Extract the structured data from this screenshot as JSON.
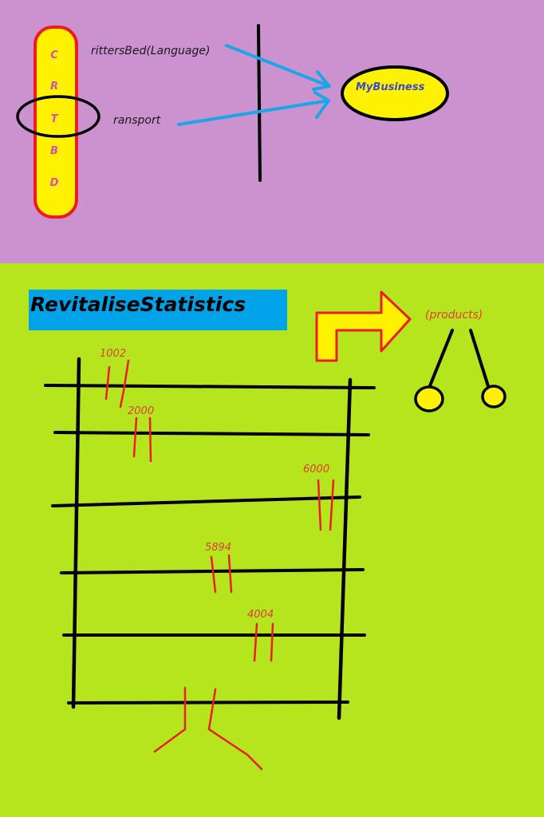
{
  "top_panel": {
    "letters": [
      "C",
      "R",
      "T",
      "B",
      "D"
    ],
    "label_language": "rittersBed(Language)",
    "label_transport": "ransport",
    "business_label": "MyBusiness"
  },
  "bottom_panel": {
    "title": "RevitaliseStatistics",
    "products_label": "(products)",
    "values": [
      "1002",
      "2000",
      "6000",
      "5894",
      "4004"
    ]
  },
  "colors": {
    "top_background": "#cc92cf",
    "bottom_background": "#b5e61d",
    "title_box": "#00a2e8",
    "yellow": "#fff200",
    "red": "#ed1c24",
    "blue_arrow": "#1ca6e6"
  }
}
